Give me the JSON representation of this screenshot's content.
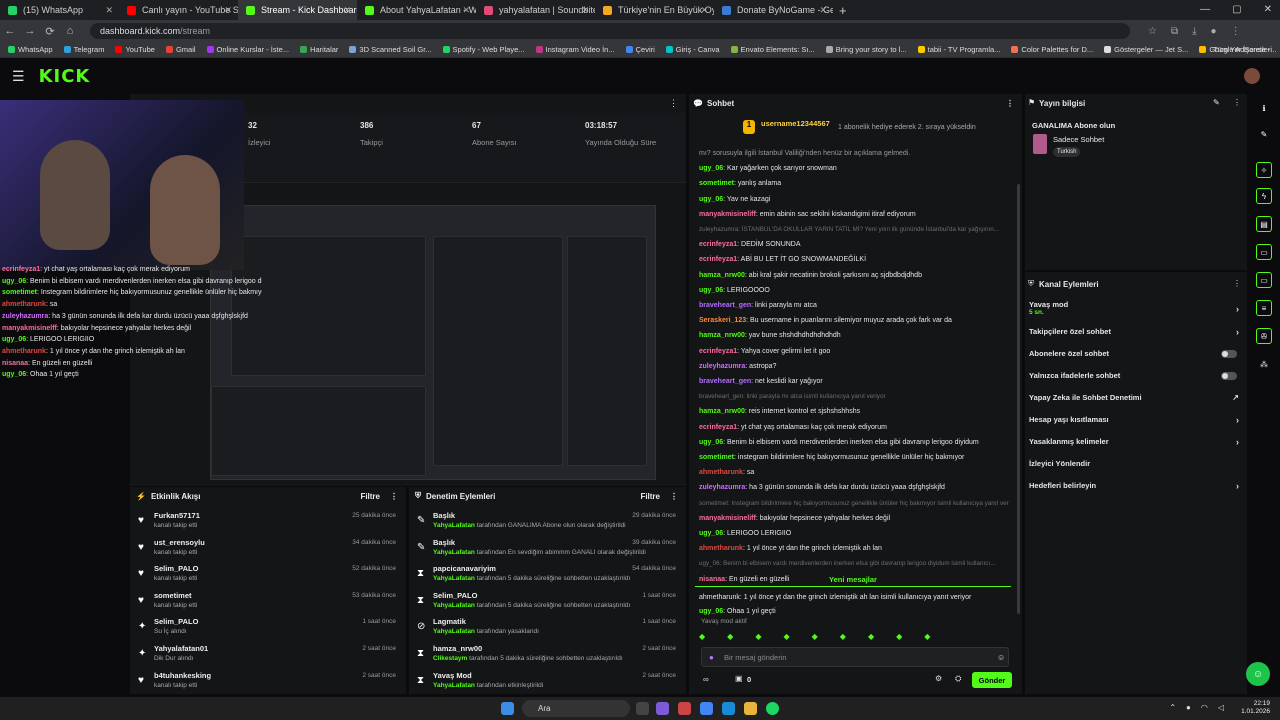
{
  "browser": {
    "tabs": [
      {
        "label": "(15) WhatsApp",
        "color": "#25d366",
        "active": false
      },
      {
        "label": "Canlı yayın - YouTube Studio",
        "color": "#ff0000",
        "active": false
      },
      {
        "label": "Stream - Kick Dashboard",
        "color": "#53fc18",
        "active": true
      },
      {
        "label": "About YahyaLafatan - Watch Li",
        "color": "#53fc18",
        "active": false
      },
      {
        "label": "yahyalafatan | Soundbites, Sou",
        "color": "#e14b7a",
        "active": false
      },
      {
        "label": "Türkiye'nin En Büyük Oyuncu D",
        "color": "#f5a623",
        "active": false
      },
      {
        "label": "Donate ByNoGame - Gelen/Gö",
        "color": "#3a7bd5",
        "active": false
      }
    ],
    "new_tab": "+",
    "url_host": "dashboard.kick.com",
    "url_path": "/stream",
    "bookmarks": [
      {
        "label": "WhatsApp",
        "color": "#25d366"
      },
      {
        "label": "Telegram",
        "color": "#2aa3e0"
      },
      {
        "label": "YouTube",
        "color": "#ff0000"
      },
      {
        "label": "Gmail",
        "color": "#ea4335"
      },
      {
        "label": "Online Kurslar - İste...",
        "color": "#a435f0"
      },
      {
        "label": "Haritalar",
        "color": "#34a853"
      },
      {
        "label": "3D Scanned Soil Gr...",
        "color": "#7aa5d6"
      },
      {
        "label": "Spotify - Web Playe...",
        "color": "#1ed760"
      },
      {
        "label": "Instagram Video İn...",
        "color": "#c13584"
      },
      {
        "label": "Çeviri",
        "color": "#4285f4"
      },
      {
        "label": "Giriş - Canva",
        "color": "#00c4cc"
      },
      {
        "label": "Envato Elements: Sı...",
        "color": "#82b541"
      },
      {
        "label": "Bring your story to l...",
        "color": "#aaaaaa"
      },
      {
        "label": "tabii - TV Programla...",
        "color": "#ffcc00"
      },
      {
        "label": "Color Palettes for D...",
        "color": "#f27059"
      },
      {
        "label": "Göstergeler — Jet S...",
        "color": "#dddddd"
      },
      {
        "label": "Google AdSense -...",
        "color": "#fbbc04"
      },
      {
        "label": "Dosyanız hazır! - Yo...",
        "color": "#ee3d4c"
      }
    ],
    "all_bookmarks": "Tüm Yer İşaretleri"
  },
  "kick": {
    "logo": "KICK"
  },
  "stream": {
    "stats": [
      {
        "value": "32",
        "label": "İzleyici"
      },
      {
        "value": "386",
        "label": "Takipçi"
      },
      {
        "value": "67",
        "label": "Abone Sayısı"
      },
      {
        "value": "03:18:57",
        "label": "Yayında Olduğu Süre"
      }
    ]
  },
  "overlay_chat": [
    {
      "user": "ecrinfeyza1",
      "color": "#ff6b9d",
      "text": ": yt chat yaş ortalaması kaç çok merak ediyorum"
    },
    {
      "user": "ugy_06",
      "color": "#53fc18",
      "text": ": Benim bi elbisem vardı merdivenlerden inerken elsa gibi davranıp lerigoo diyidum"
    },
    {
      "user": "sometimet",
      "color": "#53fc18",
      "text": ": Instegram bildirimlere hiç bakıyormusunuz genellikle ünlüler hiç bakmıyor"
    },
    {
      "user": "ahmetharunk",
      "color": "#e0473f",
      "text": ": sa"
    },
    {
      "user": "zuleyhazumra",
      "color": "#d16cff",
      "text": ": ha 3 günün sonunda ilk defa kar durdu üzücü yaaa dşfghşlskjfd"
    },
    {
      "user": "manyakmisinelff",
      "color": "#ff6b9d",
      "text": ": bakıyolar hepsinece yahyalar herkes değil"
    },
    {
      "user": "ugy_06",
      "color": "#53fc18",
      "text": ": LERIGOO LERIGIIO"
    },
    {
      "user": "ahmetharunk",
      "color": "#e0473f",
      "text": ": 1 yıl önce yt dan the grinch izlemiştik ah lan"
    },
    {
      "user": "nisanaa",
      "color": "#ff6b9d",
      "text": ": En güzeli en güzelli"
    },
    {
      "user": "ugy_06",
      "color": "#53fc18",
      "text": ": Ohaa 1 yıl geçti"
    }
  ],
  "activity": {
    "title": "Etkinlik Akışı",
    "filter": "Filtre",
    "items": [
      {
        "icon": "♥",
        "name": "Furkan57171",
        "sub": "kanalı takip etti",
        "time": "25 dakika önce"
      },
      {
        "icon": "♥",
        "name": "ust_erensoylu",
        "sub": "kanalı takip etti",
        "time": "34 dakika önce"
      },
      {
        "icon": "♥",
        "name": "Selim_PALO",
        "sub": "kanalı takip etti",
        "time": "52 dakika önce"
      },
      {
        "icon": "♥",
        "name": "sometimet",
        "sub": "kanalı takip etti",
        "time": "53 dakika önce"
      },
      {
        "icon": "✦",
        "name": "Selim_PALO",
        "sub": "Su İç alındı",
        "time": "1 saat önce"
      },
      {
        "icon": "✦",
        "name": "Yahyalafatan01",
        "sub": "Dik Dur alındı",
        "time": "2 saat önce"
      },
      {
        "icon": "♥",
        "name": "b4tuhankesking",
        "sub": "kanalı takip etti",
        "time": "2 saat önce"
      }
    ]
  },
  "moderation": {
    "title": "Denetim Eylemleri",
    "filter": "Filtre",
    "items": [
      {
        "icon": "✎",
        "name": "Başlık",
        "actor": "YahyaLafatan",
        "sub": " tarafından GANALIMA Abone olun olarak değiştirildi",
        "time": "29 dakika önce"
      },
      {
        "icon": "✎",
        "name": "Başlık",
        "actor": "YahyaLafatan",
        "sub": " tarafından En sevdiğim abimmm GANALI olarak değiştirildi",
        "time": "39 dakika önce"
      },
      {
        "icon": "⧗",
        "name": "papcicanavariyim",
        "actor": "YahyaLafatan",
        "sub": " tarafından 5 dakika süreliğine sohbetten uzaklaştırıldı",
        "time": "54 dakika önce"
      },
      {
        "icon": "⧗",
        "name": "Selim_PALO",
        "actor": "YahyaLafatan",
        "sub": " tarafından 5 dakika süreliğine sohbetten uzaklaştırıldı",
        "time": "1 saat önce"
      },
      {
        "icon": "⊘",
        "name": "Lagmatik",
        "actor": "YahyaLafatan",
        "sub": " tarafından yasaklandı",
        "time": "1 saat önce"
      },
      {
        "icon": "⧗",
        "name": "hamza_nrw00",
        "actor": "Clikestaym",
        "sub": " tarafından 5 dakika süreliğine sohbetten uzaklaştırıldı",
        "time": "2 saat önce"
      },
      {
        "icon": "⧗",
        "name": "Yavaş Mod",
        "actor": "YahyaLafatan",
        "sub": " tarafından etkinleştirildi",
        "time": "2 saat önce"
      }
    ]
  },
  "chat": {
    "title": "Sohbet",
    "pinned_user": "username12344567",
    "pinned_text": "1 abonelik hediye ederek 2. sıraya yükseldin",
    "messages": [
      {
        "user": "",
        "color": "#9a9a9a",
        "text": "mı? sorusuyla ilgili İstanbul Valiliği'nden henüz bir açıklama gelmedi.",
        "sys": false
      },
      {
        "user": "ugy_06",
        "color": "#53fc18",
        "text": ": Kar yağarken çok sarıyor snowman",
        "sys": false
      },
      {
        "user": "sometimet",
        "color": "#53fc18",
        "text": ": yanlış anlama",
        "sys": false
      },
      {
        "user": "ugy_06",
        "color": "#53fc18",
        "text": ": Yav ne kazagi",
        "sys": false
      },
      {
        "user": "manyakmisineliff",
        "color": "#ff6b9d",
        "text": ": emin abinin sac sekilni kiskandigimi itiraf ediyorum",
        "sys": false
      },
      {
        "user": "",
        "color": "#6e6e6e",
        "text": "zuleyhazumra: İSTANBUL'DA OKULLAR YARIN TATİL Mİ? Yeni yılın ilk gününde İstanbul'da kar yağışının...",
        "sys": true
      },
      {
        "user": "ecrinfeyza1",
        "color": "#ff6b9d",
        "text": ": DEDİM SONUNDA",
        "sys": false
      },
      {
        "user": "ecrinfeyza1",
        "color": "#ff6b9d",
        "text": ": ABİ BU LET İT GO SNOWMANDEĞİLKİ",
        "sys": false
      },
      {
        "user": "hamza_nrw00",
        "color": "#53fc18",
        "text": ": abi kral şakir necatinin brokoli şarkısını aç sjdbdbdjdhdb",
        "sys": false
      },
      {
        "user": "ugy_06",
        "color": "#53fc18",
        "text": ": LERIGOOOO",
        "sys": false
      },
      {
        "user": "braveheart_gen",
        "color": "#b56cff",
        "text": ": linki parayla mı atca",
        "sys": false
      },
      {
        "user": "Seraskeri_123",
        "color": "#ff8a3d",
        "text": ": Bu username in puanlarını silemiyor muyuz arada çok fark var da",
        "sys": false
      },
      {
        "user": "hamza_nrw00",
        "color": "#53fc18",
        "text": ": yav bune shshdhdhdhdhdhdh",
        "sys": false
      },
      {
        "user": "ecrinfeyza1",
        "color": "#ff6b9d",
        "text": ": Yahya cover gelirmi let it goo",
        "sys": false
      },
      {
        "user": "zuleyhazumra",
        "color": "#d16cff",
        "text": ": astropa?",
        "sys": false
      },
      {
        "user": "braveheart_gen",
        "color": "#b56cff",
        "text": ": net keslidi kar yağıyor",
        "sys": false
      },
      {
        "user": "",
        "color": "#6e6e6e",
        "text": "braveheart_gen: linki parayla mı atca isimli kullanıcıya yanıt veriyor",
        "sys": true
      },
      {
        "user": "hamza_nrw00",
        "color": "#53fc18",
        "text": ": reis internet kontrol et sjshshshhshs",
        "sys": false
      },
      {
        "user": "ecrinfeyza1",
        "color": "#ff6b9d",
        "text": ": yt chat yaş ortalaması kaç çok merak ediyorum",
        "sys": false
      },
      {
        "user": "ugy_06",
        "color": "#53fc18",
        "text": ": Benim bi elbisem vardı merdivenlerden inerken elsa gibi davranıp lerigoo diyidum",
        "sys": false
      },
      {
        "user": "sometimet",
        "color": "#53fc18",
        "text": ": instegram bildirimlere hiç bakıyormusunuz genellikle ünlüler hiç bakmıyor",
        "sys": false
      },
      {
        "user": "ahmetharunk",
        "color": "#e0473f",
        "text": ": sa",
        "sys": false
      },
      {
        "user": "zuleyhazumra",
        "color": "#d16cff",
        "text": ": ha 3 günün sonunda ilk defa kar durdu üzücü yaaa dşfghşlskjfd",
        "sys": false
      },
      {
        "user": "",
        "color": "#6e6e6e",
        "text": "sometimet: Instegram bildirimlere hiç bakıyormusunuz genellikle ünlüler hiç bakmıyor isimli kullanıcıya yanıt veriyor",
        "sys": true
      },
      {
        "user": "manyakmisineliff",
        "color": "#ff6b9d",
        "text": ": bakıyolar hepsinece yahyalar herkes değil",
        "sys": false
      },
      {
        "user": "ugy_06",
        "color": "#53fc18",
        "text": ": LERIGOO LERIGIIO",
        "sys": false
      },
      {
        "user": "ahmetharunk",
        "color": "#e0473f",
        "text": ": 1 yıl önce yt dan the grinch izlemiştik ah lan",
        "sys": false
      },
      {
        "user": "",
        "color": "#6e6e6e",
        "text": "ugy_06: Benim bi elbisem vardı merdivenlerden inerken elsa gibi davranıp lerigoo diyidum isimli kullanıcı...",
        "sys": true
      },
      {
        "user": "nisanaa",
        "color": "#ff6b9d",
        "text": ": En güzeli en güzelli",
        "sys": false
      }
    ],
    "new_messages": "Yeni mesajlar",
    "after_new": [
      {
        "user": "",
        "color": "#6e6e6e",
        "text": "ahmetharunk: 1 yıl önce yt dan the grinch izlemiştik ah lan isimli kullanıcıya yanıt veriyor",
        "sys": true
      },
      {
        "user": "ugy_06",
        "color": "#53fc18",
        "text": ": Ohaa 1 yıl geçti",
        "sys": false
      }
    ],
    "slow_mode": "Yavaş mod aktif",
    "input_placeholder": "Bir mesaj gönderin",
    "points": "0",
    "send": "Gönder"
  },
  "stream_info": {
    "title": "Yayın bilgisi",
    "stream_title": "GANALIMA Abone olun",
    "category": "Sadece Sohbet",
    "tag": "Turkish"
  },
  "channel_actions": {
    "title": "Kanal Eylemleri",
    "slow_mode": "Yavaş mod",
    "slow_mode_value": "5 sn.",
    "items": [
      {
        "label": "Takipçilere özel sohbet",
        "control": "chevron"
      },
      {
        "label": "Abonelere özel sohbet",
        "control": "toggle"
      },
      {
        "label": "Yalnızca ifadelerle sohbet",
        "control": "toggle"
      },
      {
        "label": "Yapay Zeka ile Sohbet Denetimi",
        "control": "external"
      },
      {
        "label": "Hesap yaşı kısıtlaması",
        "control": "chevron"
      },
      {
        "label": "Yasaklanmış kelimeler",
        "control": "chevron"
      },
      {
        "label": "İzleyici Yönlendir",
        "control": "none"
      },
      {
        "label": "Hedefleri belirleyin",
        "control": "chevron"
      }
    ]
  },
  "taskbar": {
    "search": "Ara",
    "time": "22:19",
    "date": "1.01.2026"
  }
}
